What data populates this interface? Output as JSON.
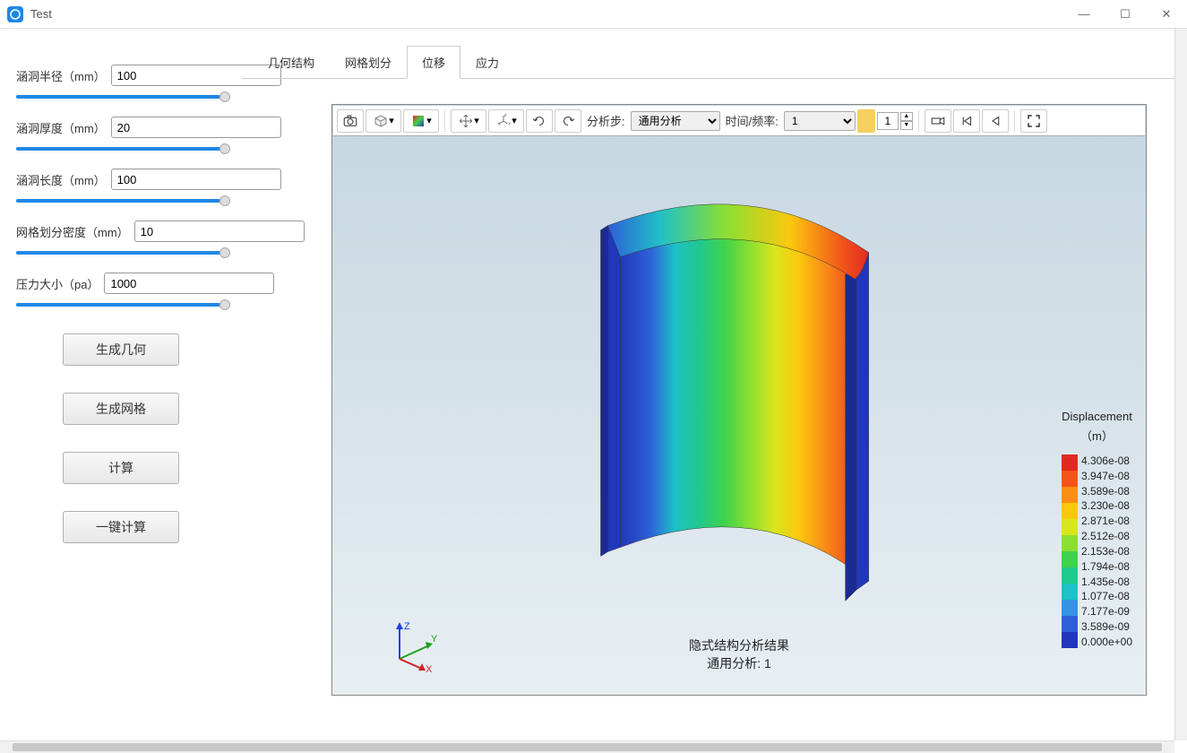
{
  "window": {
    "title": "Test"
  },
  "sidebar": {
    "params": [
      {
        "label": "涵洞半径（mm）",
        "value": "100"
      },
      {
        "label": "涵洞厚度（mm）",
        "value": "20"
      },
      {
        "label": "涵洞长度（mm）",
        "value": "100"
      },
      {
        "label": "网格划分密度（mm）",
        "value": "10"
      },
      {
        "label": "压力大小（pa）",
        "value": "1000"
      }
    ],
    "buttons": [
      {
        "label": "生成几何"
      },
      {
        "label": "生成网格"
      },
      {
        "label": "计算"
      },
      {
        "label": "一键计算"
      }
    ]
  },
  "tabs": [
    {
      "label": "几何结构"
    },
    {
      "label": "网格划分"
    },
    {
      "label": "位移"
    },
    {
      "label": "应力"
    }
  ],
  "active_tab": 2,
  "toolbar": {
    "analysis_step_label": "分析步:",
    "analysis_step_value": "通用分析",
    "time_freq_label": "时间/频率:",
    "time_freq_value": "1",
    "frame_value": "1"
  },
  "result_caption": {
    "line1": "隐式结构分析结果",
    "line2": "通用分析: 1"
  },
  "axis": {
    "x": "X",
    "y": "Y",
    "z": "Z"
  },
  "legend": {
    "title": "Displacement",
    "unit": "（m）",
    "colors": [
      "#e12a1f",
      "#f2551a",
      "#f98f18",
      "#fcc80e",
      "#d8e61f",
      "#8adf32",
      "#3fd24a",
      "#20c98e",
      "#1fc0c7",
      "#3494e3",
      "#2e5fd8",
      "#2037bb"
    ],
    "values": [
      "4.306e-08",
      "3.947e-08",
      "3.589e-08",
      "3.230e-08",
      "2.871e-08",
      "2.512e-08",
      "2.153e-08",
      "1.794e-08",
      "1.435e-08",
      "1.077e-08",
      "7.177e-09",
      "3.589e-09",
      "0.000e+00"
    ]
  },
  "chart_data": {
    "type": "heatmap",
    "title": "Displacement (m)",
    "variable": "Displacement",
    "unit": "m",
    "range": [
      0.0,
      4.306e-08
    ],
    "color_stops": [
      {
        "value": 4.306e-08,
        "color": "#e12a1f"
      },
      {
        "value": 3.947e-08,
        "color": "#f2551a"
      },
      {
        "value": 3.589e-08,
        "color": "#f98f18"
      },
      {
        "value": 3.23e-08,
        "color": "#fcc80e"
      },
      {
        "value": 2.871e-08,
        "color": "#d8e61f"
      },
      {
        "value": 2.512e-08,
        "color": "#8adf32"
      },
      {
        "value": 2.153e-08,
        "color": "#3fd24a"
      },
      {
        "value": 1.794e-08,
        "color": "#20c98e"
      },
      {
        "value": 1.435e-08,
        "color": "#1fc0c7"
      },
      {
        "value": 1.077e-08,
        "color": "#3494e3"
      },
      {
        "value": 7.177e-09,
        "color": "#2e5fd8"
      },
      {
        "value": 3.589e-09,
        "color": "#2037bb"
      },
      {
        "value": 0.0,
        "color": "#2037bb"
      }
    ]
  }
}
